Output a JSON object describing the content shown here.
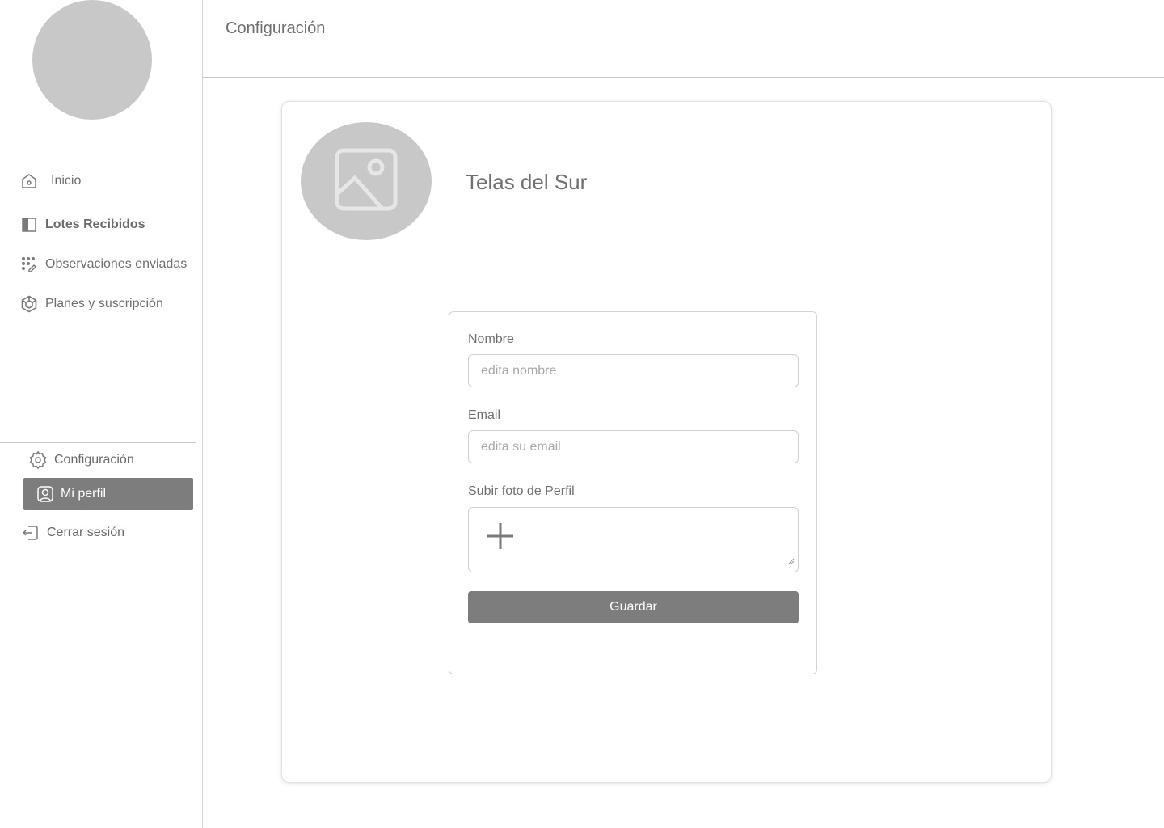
{
  "sidebar": {
    "nav": [
      {
        "label": "Inicio",
        "icon": "home-icon"
      },
      {
        "label": "Lotes Recibidos",
        "icon": "book-icon"
      },
      {
        "label": "Observaciones enviadas",
        "icon": "grid-pen-icon"
      },
      {
        "label": "Planes y suscripción",
        "icon": "cube-icon"
      }
    ],
    "footer": {
      "config_label": "Configuración",
      "perfil_label": "Mi perfil",
      "logout_label": "Cerrar sesión"
    }
  },
  "header": {
    "title": "Configuración"
  },
  "profile": {
    "company_name": "Telas del Sur",
    "form": {
      "nombre_label": "Nombre",
      "nombre_placeholder": "edita nombre",
      "email_label": "Email",
      "email_placeholder": "edita su email",
      "foto_label": "Subir foto de Perfil",
      "save_label": "Guardar"
    }
  },
  "colors": {
    "active_bg": "#7d7d7d",
    "placeholder_gray": "#c8c8c8",
    "text": "#707070"
  }
}
